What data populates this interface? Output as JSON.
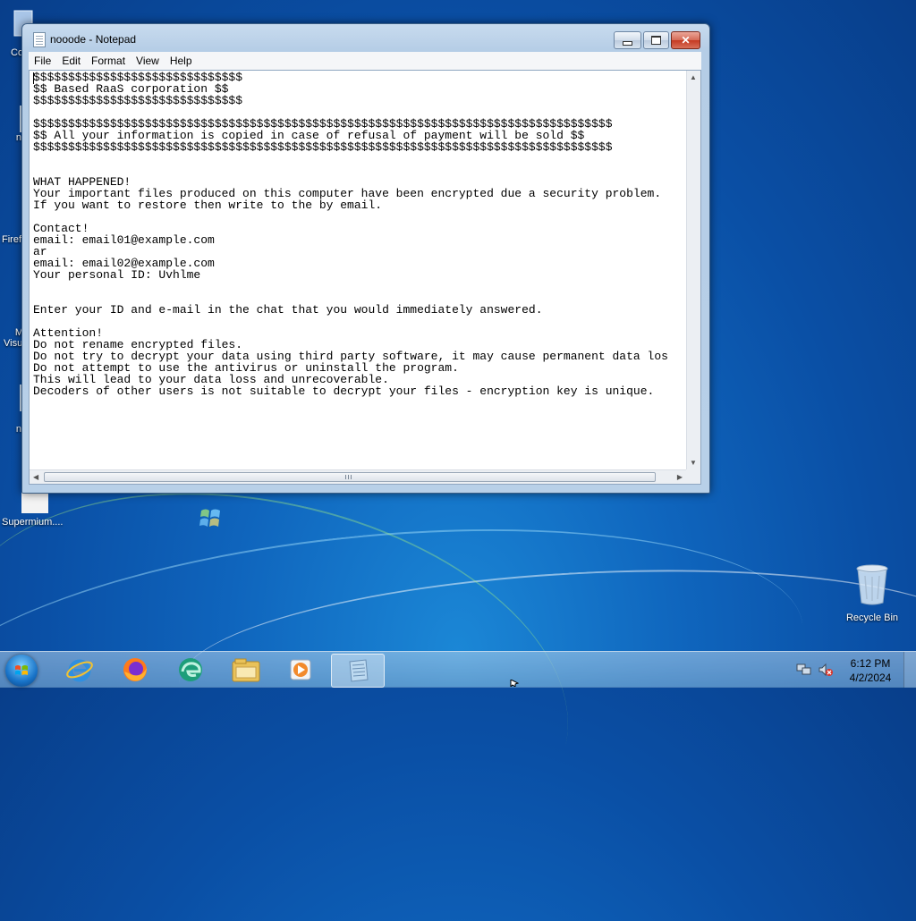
{
  "desktop": {
    "icons": [
      {
        "label": "Co"
      },
      {
        "label": "n"
      },
      {
        "label": "Firef"
      },
      {
        "label": "M"
      },
      {
        "label": "Visu"
      },
      {
        "label": "n"
      },
      {
        "label": "Supermium...."
      },
      {
        "label": "Recycle Bin"
      }
    ]
  },
  "window": {
    "title": "nooode - Notepad",
    "menu": [
      "File",
      "Edit",
      "Format",
      "View",
      "Help"
    ],
    "lines": [
      "$$$$$$$$$$$$$$$$$$$$$$$$$$$$$$",
      "$$ Based RaaS corporation $$",
      "$$$$$$$$$$$$$$$$$$$$$$$$$$$$$$",
      "",
      "$$$$$$$$$$$$$$$$$$$$$$$$$$$$$$$$$$$$$$$$$$$$$$$$$$$$$$$$$$$$$$$$$$$$$$$$$$$$$$$$$$$",
      "$$ All your information is copied in case of refusal of payment will be sold $$",
      "$$$$$$$$$$$$$$$$$$$$$$$$$$$$$$$$$$$$$$$$$$$$$$$$$$$$$$$$$$$$$$$$$$$$$$$$$$$$$$$$$$$",
      "",
      "",
      "WHAT HAPPENED!",
      "Your important files produced on this computer have been encrypted due a security problem.",
      "If you want to restore then write to the by email.",
      "",
      "Contact!",
      "email: email01@example.com",
      "ar",
      "email: email02@example.com",
      "Your personal ID: Uvhlme",
      "",
      "",
      "Enter your ID and e-mail in the chat that you would immediately answered.",
      "",
      "Attention!",
      "Do not rename encrypted files.",
      "Do not try to decrypt your data using third party software, it may cause permanent data los",
      "Do not attempt to use the antivirus or uninstall the program.",
      "This will lead to your data loss and unrecoverable.",
      "Decoders of other users is not suitable to decrypt your files - encryption key is unique."
    ]
  },
  "taskbar": {
    "clock_time": "6:12 PM",
    "clock_date": "4/2/2024"
  },
  "colors": {
    "desktop": "#0f65bd",
    "close_button": "#c53a22"
  }
}
